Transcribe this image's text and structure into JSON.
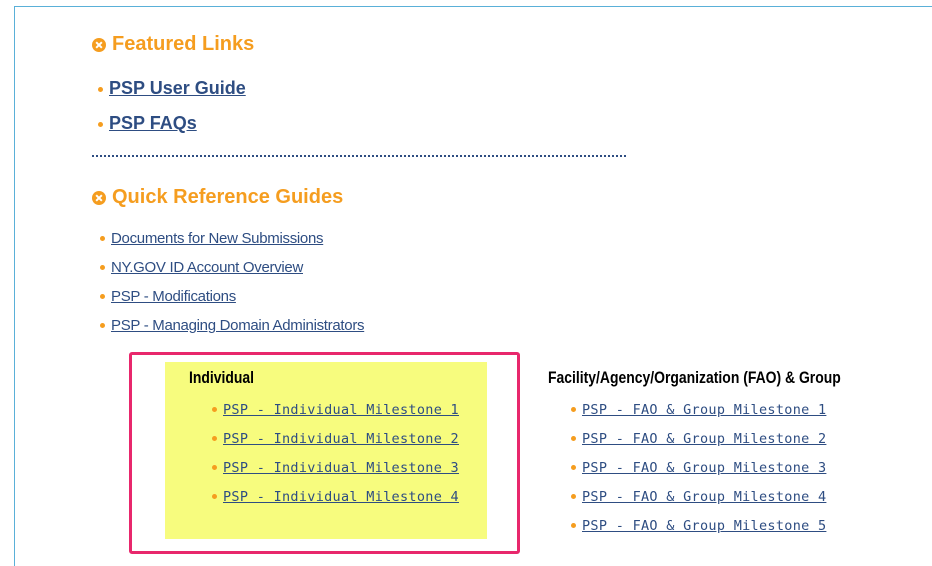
{
  "featured": {
    "title": "Featured Links",
    "links": [
      "PSP User Guide",
      "PSP FAQs"
    ]
  },
  "quick_reference": {
    "title": "Quick Reference Guides",
    "links": [
      "Documents for New Submissions",
      "NY.GOV ID Account Overview",
      "PSP - Modifications",
      "PSP - Managing Domain Administrators"
    ]
  },
  "individual": {
    "heading": "Individual",
    "links": [
      "PSP - Individual Milestone 1",
      "PSP - Individual Milestone 2",
      "PSP - Individual Milestone 3",
      "PSP - Individual Milestone 4"
    ]
  },
  "fao": {
    "heading": "Facility/Agency/Organization (FAO) & Group",
    "links": [
      "PSP - FAO & Group Milestone 1",
      "PSP - FAO & Group Milestone 2",
      "PSP - FAO & Group Milestone 3",
      "PSP - FAO & Group Milestone 4",
      "PSP - FAO & Group Milestone 5"
    ]
  },
  "colors": {
    "accent": "#f59d1f",
    "link": "#2e4d82",
    "highlight": "#f7fc7e",
    "annotation_border": "#e8276c",
    "frame_border": "#5ab0d8"
  }
}
